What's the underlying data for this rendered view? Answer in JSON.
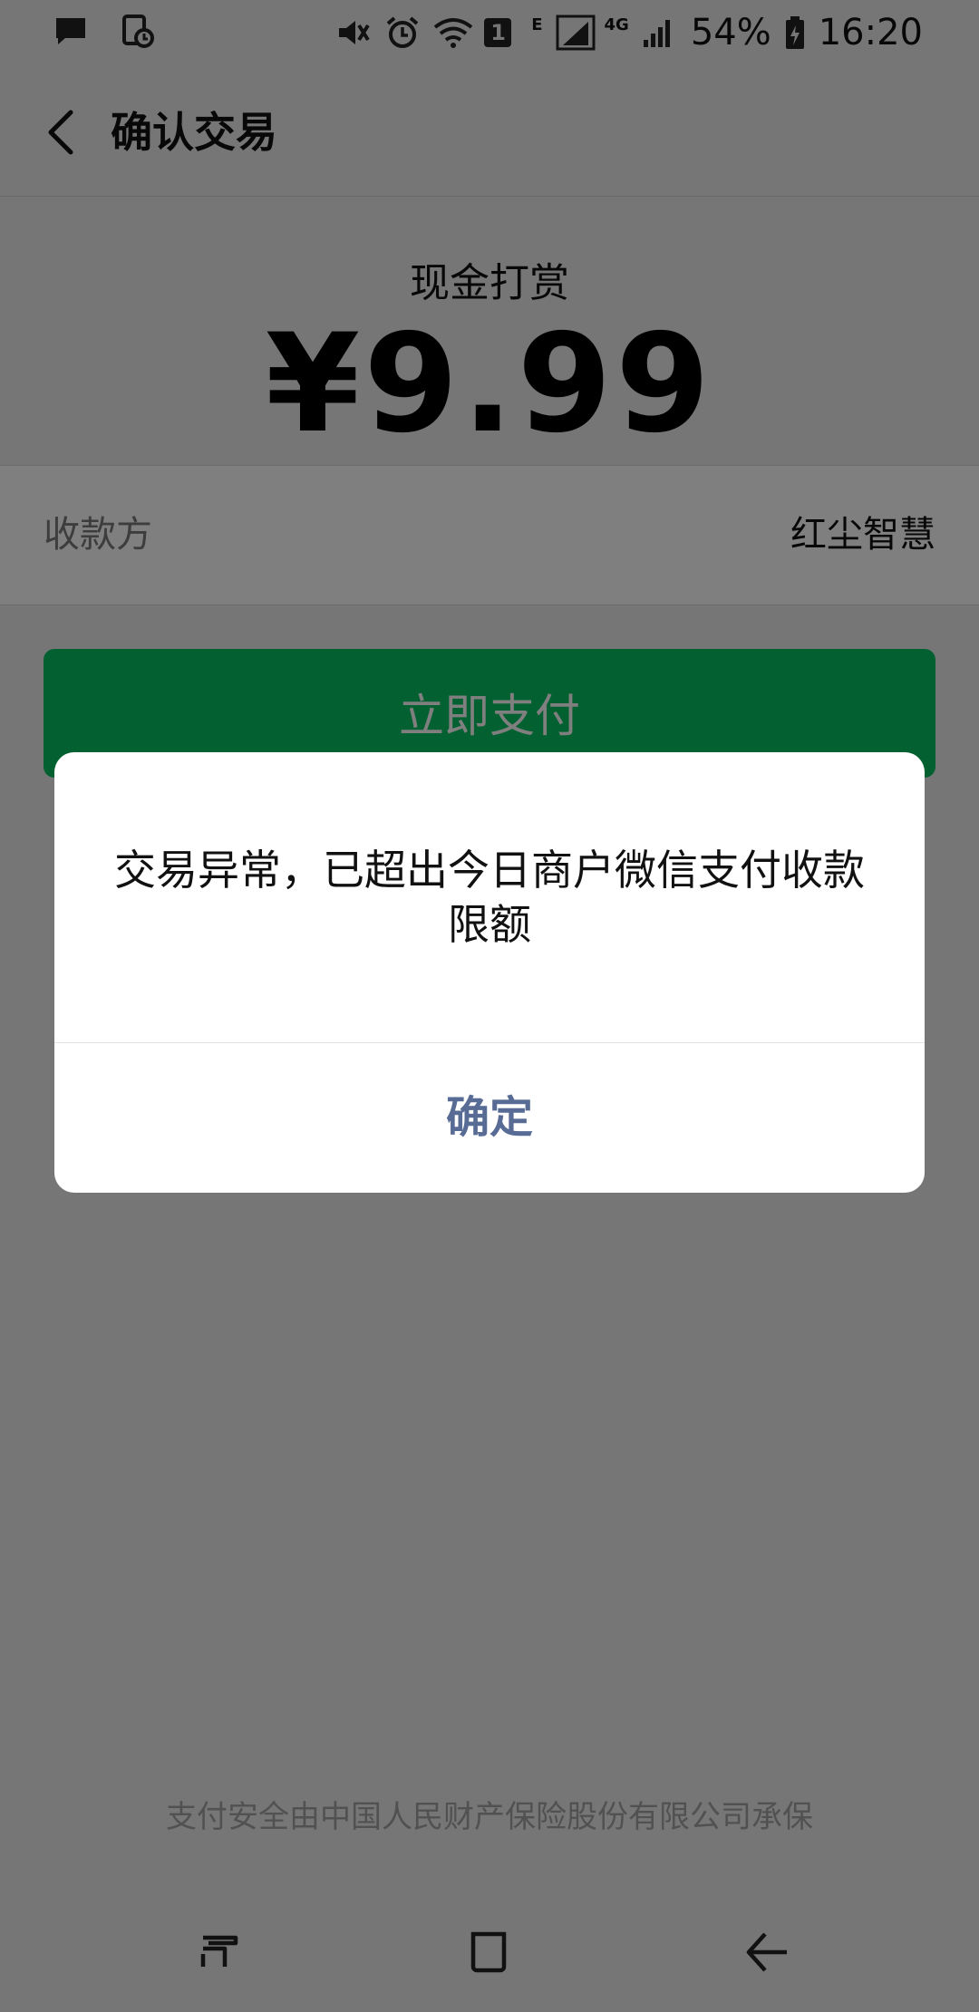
{
  "status_bar": {
    "network_small": "E",
    "network_4g": "4G",
    "battery": "54%",
    "time": "16:20",
    "sim_number": "1"
  },
  "header": {
    "title": "确认交易"
  },
  "payment": {
    "label": "现金打赏",
    "amount": "¥9.99"
  },
  "payee": {
    "label": "收款方",
    "value": "红尘智慧"
  },
  "pay_button": {
    "label": "立即支付"
  },
  "footer": {
    "note": "支付安全由中国人民财产保险股份有限公司承保"
  },
  "dialog": {
    "message": "交易异常，已超出今日商户微信支付收款限额",
    "confirm_label": "确定"
  },
  "colors": {
    "accent_green": "#07c160",
    "link_blue": "#576b95",
    "overlay": "rgba(0,0,0,0.5)"
  },
  "icons": {
    "status_left": [
      "message-icon",
      "calendar-clock-icon"
    ],
    "status_right": [
      "mute-icon",
      "alarm-icon",
      "wifi-icon",
      "sim-icon",
      "signal-icon",
      "battery-icon"
    ],
    "nav": [
      "recent-apps-icon",
      "home-icon",
      "back-icon"
    ]
  }
}
